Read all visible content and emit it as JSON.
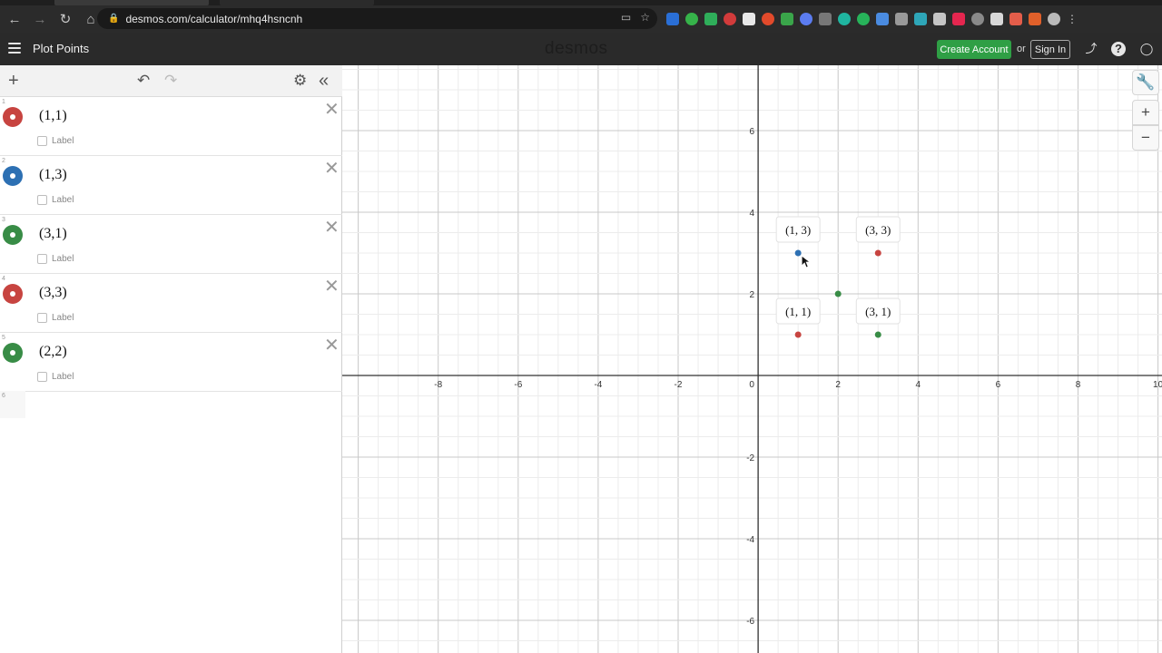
{
  "browser": {
    "url": "desmos.com/calculator/mhq4hsncnh"
  },
  "header": {
    "title": "Plot Points",
    "logo_text": "desmos",
    "create_account_label": "Create Account",
    "or_text": "or",
    "sign_in_label": "Sign In"
  },
  "expressions": [
    {
      "index": "1",
      "latex": "(1,1)",
      "label_text": "Label",
      "color": "#c74440"
    },
    {
      "index": "2",
      "latex": "(1,3)",
      "label_text": "Label",
      "color": "#2d70b3"
    },
    {
      "index": "3",
      "latex": "(3,1)",
      "label_text": "Label",
      "color": "#388c46"
    },
    {
      "index": "4",
      "latex": "(3,3)",
      "label_text": "Label",
      "color": "#c74440"
    },
    {
      "index": "5",
      "latex": "(2,2)",
      "label_text": "Label",
      "color": "#388c46"
    },
    {
      "index": "6"
    }
  ],
  "graph": {
    "x_range": [
      -10.4,
      10.1
    ],
    "y_range": [
      -6.8,
      7.6
    ],
    "x_ticks": [
      "-8",
      "-6",
      "-4",
      "-2",
      "0",
      "2",
      "4",
      "6",
      "8",
      "10"
    ],
    "y_ticks": [
      "6",
      "4",
      "2",
      "-2",
      "-4",
      "-6"
    ],
    "points": [
      {
        "x": 1,
        "y": 1,
        "color": "#c74440",
        "label": "(1, 1)"
      },
      {
        "x": 1,
        "y": 3,
        "color": "#2d70b3",
        "label": "(1, 3)"
      },
      {
        "x": 3,
        "y": 1,
        "color": "#388c46",
        "label": "(3, 1)"
      },
      {
        "x": 3,
        "y": 3,
        "color": "#c74440",
        "label": "(3, 3)"
      },
      {
        "x": 2,
        "y": 2,
        "color": "#388c46",
        "label": ""
      }
    ]
  }
}
